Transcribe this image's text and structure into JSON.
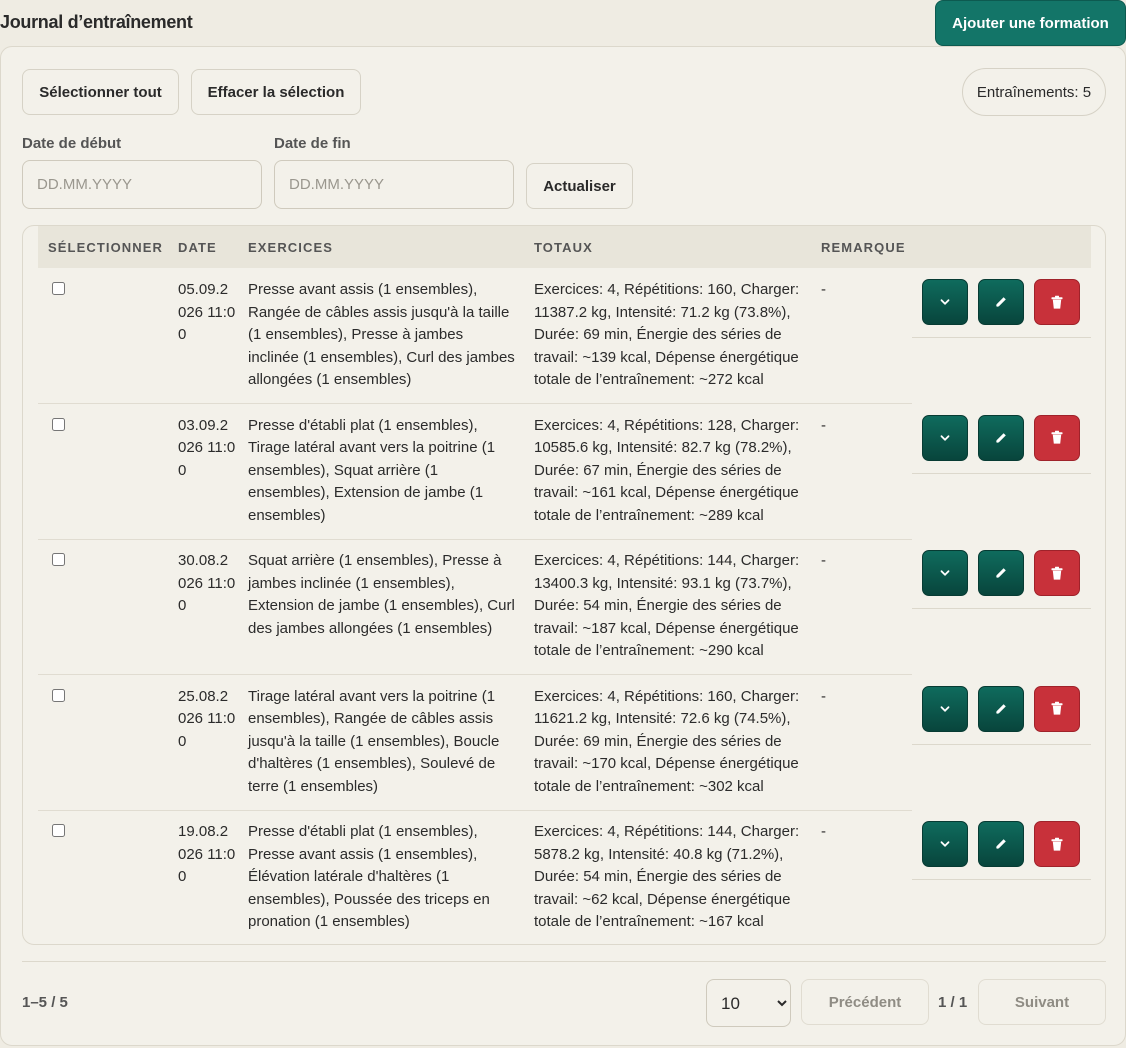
{
  "header": {
    "title": "Journal d’entraînement",
    "add_button": "Ajouter une formation"
  },
  "toolbar": {
    "select_all": "Sélectionner tout",
    "clear_selection": "Effacer la sélection",
    "counter": "Entraînements: 5"
  },
  "filters": {
    "start_label": "Date de début",
    "end_label": "Date de fin",
    "placeholder": "DD.MM.YYYY",
    "refresh": "Actualiser"
  },
  "table": {
    "columns": [
      "SÉLECTIONNER",
      "DATE",
      "EXERCICES",
      "TOTAUX",
      "REMARQUE"
    ],
    "rows": [
      {
        "date": "05.09.2026 11:00",
        "exercises": "Presse avant assis (1 ensembles), Rangée de câbles assis jusqu'à la taille (1 ensembles), Presse à jambes inclinée (1 ensembles), Curl des jambes allongées (1 ensembles)",
        "totals": "Exercices: 4, Répétitions: 160, Charger: 11387.2 kg, Intensité: 71.2 kg (73.8%), Durée: 69 min, Énergie des séries de travail: ~139 kcal, Dépense énergétique totale de l’entraînement: ~272 kcal",
        "remark": "-"
      },
      {
        "date": "03.09.2026 11:00",
        "exercises": "Presse d'établi plat (1 ensembles), Tirage latéral avant vers la poitrine (1 ensembles), Squat arrière (1 ensembles), Extension de jambe (1 ensembles)",
        "totals": "Exercices: 4, Répétitions: 128, Charger: 10585.6 kg, Intensité: 82.7 kg (78.2%), Durée: 67 min, Énergie des séries de travail: ~161 kcal, Dépense énergétique totale de l’entraînement: ~289 kcal",
        "remark": "-"
      },
      {
        "date": "30.08.2026 11:00",
        "exercises": "Squat arrière (1 ensembles), Presse à jambes inclinée (1 ensembles), Extension de jambe (1 ensembles), Curl des jambes allongées (1 ensembles)",
        "totals": "Exercices: 4, Répétitions: 144, Charger: 13400.3 kg, Intensité: 93.1 kg (73.7%), Durée: 54 min, Énergie des séries de travail: ~187 kcal, Dépense énergétique totale de l’entraînement: ~290 kcal",
        "remark": "-"
      },
      {
        "date": "25.08.2026 11:00",
        "exercises": "Tirage latéral avant vers la poitrine (1 ensembles), Rangée de câbles assis jusqu'à la taille (1 ensembles), Boucle d'haltères (1 ensembles), Soulevé de terre (1 ensembles)",
        "totals": "Exercices: 4, Répétitions: 160, Charger: 11621.2 kg, Intensité: 72.6 kg (74.5%), Durée: 69 min, Énergie des séries de travail: ~170 kcal, Dépense énergétique totale de l’entraînement: ~302 kcal",
        "remark": "-"
      },
      {
        "date": "19.08.2026 11:00",
        "exercises": "Presse d'établi plat (1 ensembles), Presse avant assis (1 ensembles), Élévation latérale d'haltères (1 ensembles), Poussée des triceps en pronation (1 ensembles)",
        "totals": "Exercices: 4, Répétitions: 144, Charger: 5878.2 kg, Intensité: 40.8 kg (71.2%), Durée: 54 min, Énergie des séries de travail: ~62 kcal, Dépense énergétique totale de l’entraînement: ~167 kcal",
        "remark": "-"
      }
    ],
    "actions": [
      "chevron-down-icon",
      "pencil-icon",
      "trash-icon"
    ]
  },
  "pagination": {
    "range": "1–5 / 5",
    "page_size": "10",
    "prev": "Précédent",
    "page": "1 / 1",
    "next": "Suivant"
  },
  "colors": {
    "accent": "#137568",
    "action_green": "#0f6b5d",
    "danger": "#c8313a",
    "background": "#efece3"
  }
}
